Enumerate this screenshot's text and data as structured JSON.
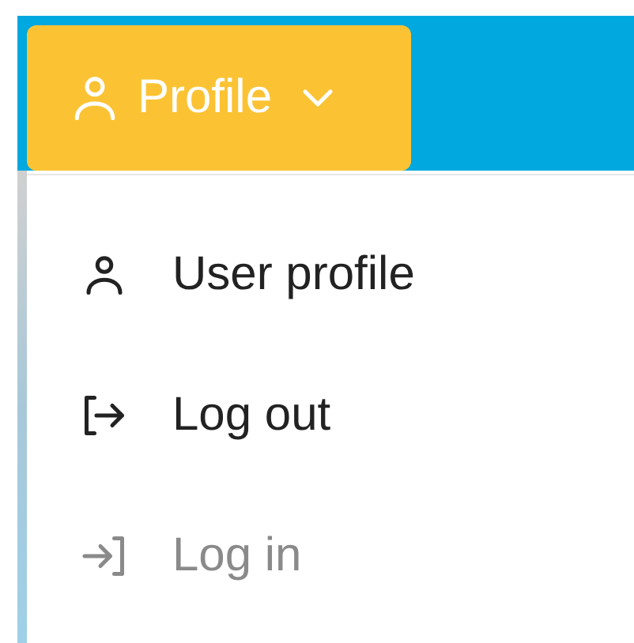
{
  "profile_button": {
    "label": "Profile",
    "expanded": true
  },
  "menu": {
    "items": [
      {
        "kind": "user",
        "label": "User profile",
        "disabled": false
      },
      {
        "kind": "logout",
        "label": "Log out",
        "disabled": false
      },
      {
        "kind": "login",
        "label": "Log in",
        "disabled": true
      }
    ]
  }
}
